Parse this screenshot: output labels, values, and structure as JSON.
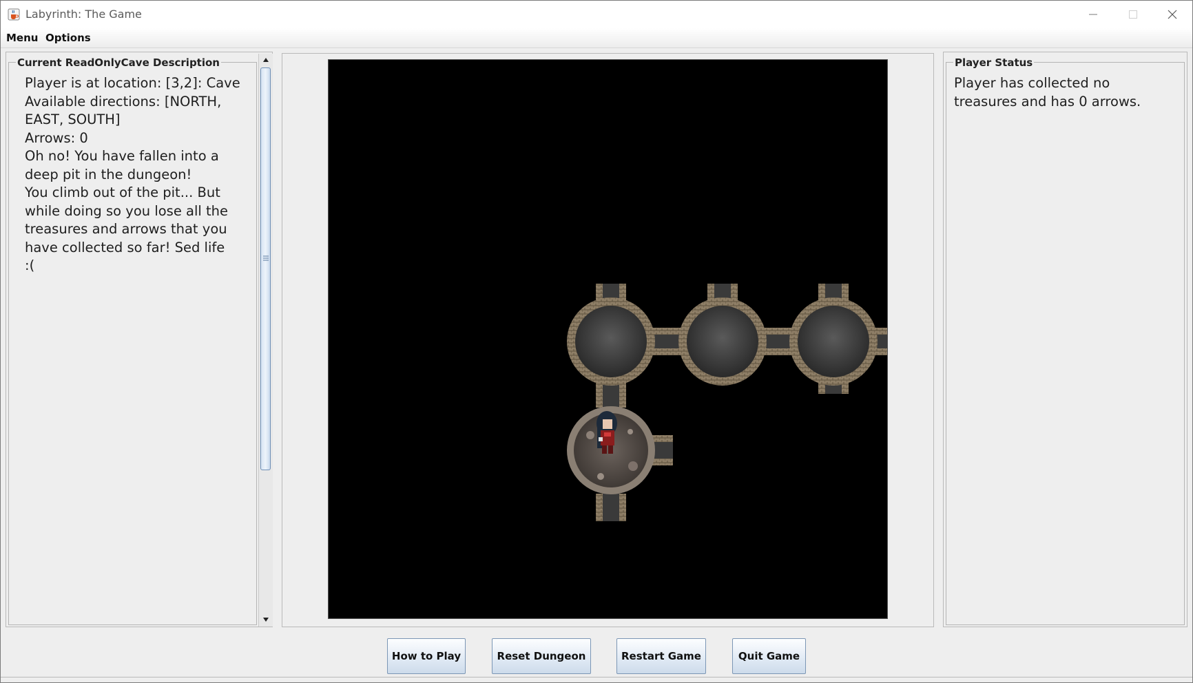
{
  "window": {
    "title": "Labyrinth: The Game",
    "minimize_label": "─",
    "maximize_label": "☐",
    "close_label": "✕"
  },
  "menubar": {
    "items": [
      "Menu",
      "Options"
    ]
  },
  "description_panel": {
    "title": "Current ReadOnlyCave Description",
    "lines": [
      "Player is at location: [3,2]: Cave",
      "Available directions: [NORTH,",
      "EAST, SOUTH]",
      "Arrows: 0",
      "Oh no! You have fallen into a",
      "deep pit in the dungeon!",
      "You climb out of the pit... But",
      "while doing so you lose all the",
      "treasures and arrows that you",
      "have collected so far! Sed life",
      ":("
    ]
  },
  "status_panel": {
    "title": "Player Status",
    "lines": [
      "Player has collected no",
      "treasures and has 0 arrows."
    ]
  },
  "buttons": {
    "how_to_play": "How to Play",
    "reset_dungeon": "Reset Dungeon",
    "restart_game": "Restart Game",
    "quit_game": "Quit Game"
  },
  "icons": {
    "app": "java-cup-icon",
    "player": "player-sprite-icon",
    "scroll_up": "arrow-up-icon",
    "scroll_down": "arrow-down-icon"
  },
  "colors": {
    "map_background": "#000000",
    "stone_border": "#8e7e66",
    "cave_floor": "#3e3e3e",
    "button_border": "#7b96b5"
  }
}
